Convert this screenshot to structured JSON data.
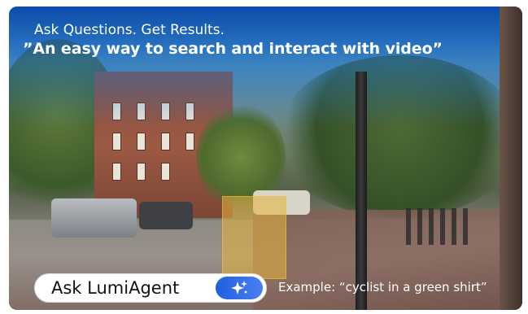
{
  "banner": {
    "tagline": "Ask Questions. Get Results.",
    "headline": "”An easy way to search and interact with video”"
  },
  "search": {
    "button_label": "Ask LumiAgent",
    "action_icon": "sparkle-icon",
    "example_text": "Example:  “cyclist in a green shirt”"
  },
  "colors": {
    "accent": "#2f6fe8",
    "text_light": "#ffffff",
    "pill_bg": "#ffffff",
    "highlight": "#e8b43c"
  }
}
